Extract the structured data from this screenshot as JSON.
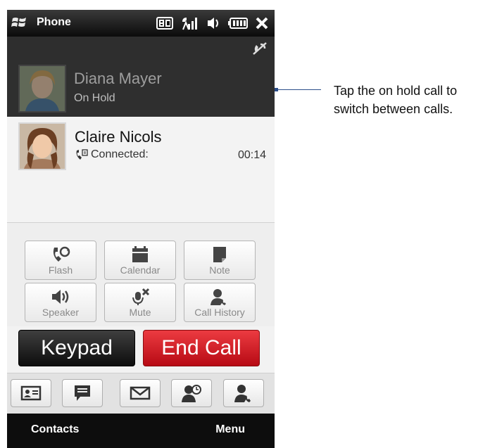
{
  "status_bar": {
    "app_title": "Phone",
    "icons": [
      "windows-flag-icon",
      "3g-icon",
      "signal-icon",
      "speaker-ring-icon",
      "battery-icon",
      "close-icon"
    ]
  },
  "subbar": {
    "icon": "mute-crossed-icon"
  },
  "hold_call": {
    "name": "Diana Mayer",
    "status": "On Hold"
  },
  "active_call": {
    "name": "Claire Nicols",
    "status": "Connected:",
    "timer": "00:14"
  },
  "function_buttons": [
    {
      "label": "Flash",
      "icon": "flash-phone-icon"
    },
    {
      "label": "Calendar",
      "icon": "calendar-icon"
    },
    {
      "label": "Note",
      "icon": "note-icon"
    },
    {
      "label": "Speaker",
      "icon": "speaker-icon"
    },
    {
      "label": "Mute",
      "icon": "mute-mic-icon"
    },
    {
      "label": "Call History",
      "icon": "call-history-icon"
    }
  ],
  "big_buttons": {
    "keypad": "Keypad",
    "end_call": "End Call"
  },
  "quick_buttons": [
    "contact-card-icon",
    "message-icon",
    "email-icon",
    "contact-clock-icon",
    "contact-phone-icon"
  ],
  "soft_keys": {
    "left": "Contacts",
    "right": "Menu"
  },
  "callout": {
    "text": "Tap the on hold call to switch between calls."
  },
  "colors": {
    "end_call": "#d2151f",
    "keypad": "#1a1a1a",
    "callout_line": "#2c4e8a"
  }
}
